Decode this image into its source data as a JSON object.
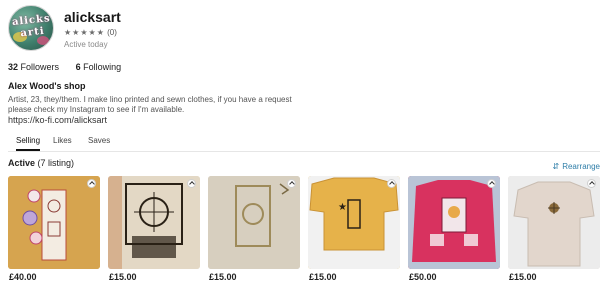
{
  "profile": {
    "avatar_text": "alicks arti",
    "username": "alicksart",
    "stars": "★★★★★",
    "review_count": "(0)",
    "status": "Active today"
  },
  "follow": {
    "followers_count": "32",
    "followers_label": "Followers",
    "following_count": "6",
    "following_label": "Following"
  },
  "shop": {
    "title": "Alex Wood's shop",
    "bio": "Artist, 23, they/them. I make lino printed and sewn clothes, if you have a request please check my Instagram to see if I'm available.",
    "link": "https://ko-fi.com/alicksart"
  },
  "tabs": [
    "Selling",
    "Likes",
    "Saves"
  ],
  "listings_header": {
    "label": "Active",
    "count": "(7 listing)",
    "rearrange_label": "Rearrange",
    "rearrange_icon": "⇵"
  },
  "listings": [
    {
      "price": "£40.00",
      "color": "#d9a84f",
      "icon": "bump-icon"
    },
    {
      "price": "£15.00",
      "color": "#e8e0d0",
      "icon": "bump-icon"
    },
    {
      "price": "£15.00",
      "color": "#d8d1c2",
      "icon": "bump-icon"
    },
    {
      "price": "£15.00",
      "color": "#e6b24a",
      "icon": "bump-icon"
    },
    {
      "price": "£50.00",
      "color": "#d8325f",
      "icon": "bump-icon"
    },
    {
      "price": "£15.00",
      "color": "#ddd3c9",
      "icon": "bump-icon"
    }
  ]
}
